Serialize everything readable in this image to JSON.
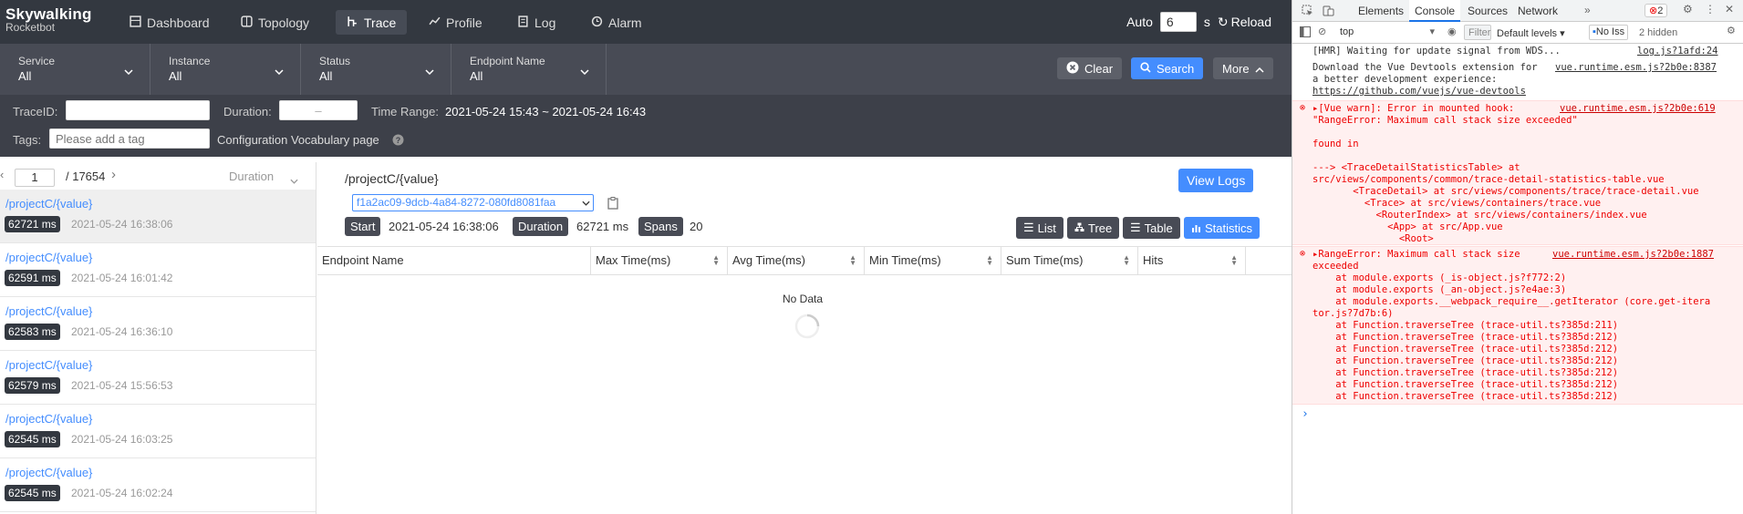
{
  "brand": {
    "line1": "Skywalking",
    "line2": "Rocketbot"
  },
  "nav": {
    "dashboard": "Dashboard",
    "topology": "Topology",
    "trace": "Trace",
    "profile": "Profile",
    "log": "Log",
    "alarm": "Alarm"
  },
  "auto": {
    "label": "Auto",
    "value": "6",
    "unit": "s",
    "reload": "Reload"
  },
  "filters": {
    "service": {
      "label": "Service",
      "value": "All"
    },
    "instance": {
      "label": "Instance",
      "value": "All"
    },
    "status": {
      "label": "Status",
      "value": "All"
    },
    "endpoint": {
      "label": "Endpoint Name",
      "value": "All"
    },
    "clear": "Clear",
    "search": "Search",
    "more": "More"
  },
  "conditions": {
    "trace_id_label": "TraceID:",
    "trace_id_value": "",
    "duration_label": "Duration:",
    "duration_value": "–",
    "time_range_label": "Time Range:",
    "time_range_value": "2021-05-24 15:43 ~ 2021-05-24 16:43",
    "tags_label": "Tags:",
    "tags_placeholder": "Please add a tag",
    "vocab_label": "Configuration Vocabulary page"
  },
  "pager": {
    "page": "1",
    "total": "/ 17654",
    "sort": "Duration"
  },
  "traces": [
    {
      "endpoint": "/projectC/{value}",
      "duration": "62721 ms",
      "time": "2021-05-24 16:38:06"
    },
    {
      "endpoint": "/projectC/{value}",
      "duration": "62591 ms",
      "time": "2021-05-24 16:01:42"
    },
    {
      "endpoint": "/projectC/{value}",
      "duration": "62583 ms",
      "time": "2021-05-24 16:36:10"
    },
    {
      "endpoint": "/projectC/{value}",
      "duration": "62579 ms",
      "time": "2021-05-24 15:56:53"
    },
    {
      "endpoint": "/projectC/{value}",
      "duration": "62545 ms",
      "time": "2021-05-24 16:03:25"
    },
    {
      "endpoint": "/projectC/{value}",
      "duration": "62545 ms",
      "time": "2021-05-24 16:02:24"
    }
  ],
  "detail": {
    "title": "/projectC/{value}",
    "view_logs": "View Logs",
    "trace_id": "f1a2ac09-9dcb-4a84-8272-080fd8081faa",
    "start_label": "Start",
    "start_value": "2021-05-24 16:38:06",
    "duration_label": "Duration",
    "duration_value": "62721 ms",
    "spans_label": "Spans",
    "spans_value": "20",
    "tabs": {
      "list": "List",
      "tree": "Tree",
      "table": "Table",
      "statistics": "Statistics"
    },
    "columns": [
      "Endpoint Name",
      "Max Time(ms)",
      "Avg Time(ms)",
      "Min Time(ms)",
      "Sum Time(ms)",
      "Hits"
    ],
    "empty": "No Data"
  },
  "devtools": {
    "tabs": [
      "Elements",
      "Console",
      "Sources",
      "Network"
    ],
    "err_count": "2",
    "context": "top",
    "filter": "Filter",
    "levels": "Default levels",
    "no_issues": "No Iss",
    "hidden": "2 hidden",
    "lines": [
      {
        "text": "[HMR] Waiting for update signal from WDS...",
        "src": "log.js?1afd:24"
      },
      {
        "text": "Download the Vue Devtools extension for",
        "src": "vue.runtime.esm.js?2b0e:8387"
      },
      {
        "text": "a better development experience:"
      },
      {
        "text": "https://github.com/vuejs/vue-devtools"
      }
    ],
    "err1": {
      "head": "▸[Vue warn]: Error in mounted hook:",
      "src": "vue.runtime.esm.js?2b0e:619",
      "lines": [
        "\"RangeError: Maximum call stack size exceeded\"",
        "",
        "found in",
        "",
        "---> <TraceDetailStatisticsTable> at",
        "src/views/components/common/trace-detail-statistics-table.vue",
        "       <TraceDetail> at src/views/components/trace/trace-detail.vue",
        "         <Trace> at src/views/containers/trace.vue",
        "           <RouterIndex> at src/views/containers/index.vue",
        "             <App> at src/App.vue",
        "               <Root>"
      ]
    },
    "err2": {
      "head": "▸RangeError: Maximum call stack size",
      "src": "vue.runtime.esm.js?2b0e:1887",
      "lines": [
        "exceeded",
        "    at module.exports (_is-object.js?f772:2)",
        "    at module.exports (_an-object.js?e4ae:3)",
        "    at module.exports.__webpack_require__.getIterator (core.get-itera",
        "tor.js?7d7b:6)",
        "    at Function.traverseTree (trace-util.ts?385d:211)",
        "    at Function.traverseTree (trace-util.ts?385d:212)",
        "    at Function.traverseTree (trace-util.ts?385d:212)",
        "    at Function.traverseTree (trace-util.ts?385d:212)",
        "    at Function.traverseTree (trace-util.ts?385d:212)",
        "    at Function.traverseTree (trace-util.ts?385d:212)",
        "    at Function.traverseTree (trace-util.ts?385d:212)",
        "    at Function.traverseTree (trace-util.ts?385d:212)"
      ]
    },
    "prompt": "›"
  }
}
